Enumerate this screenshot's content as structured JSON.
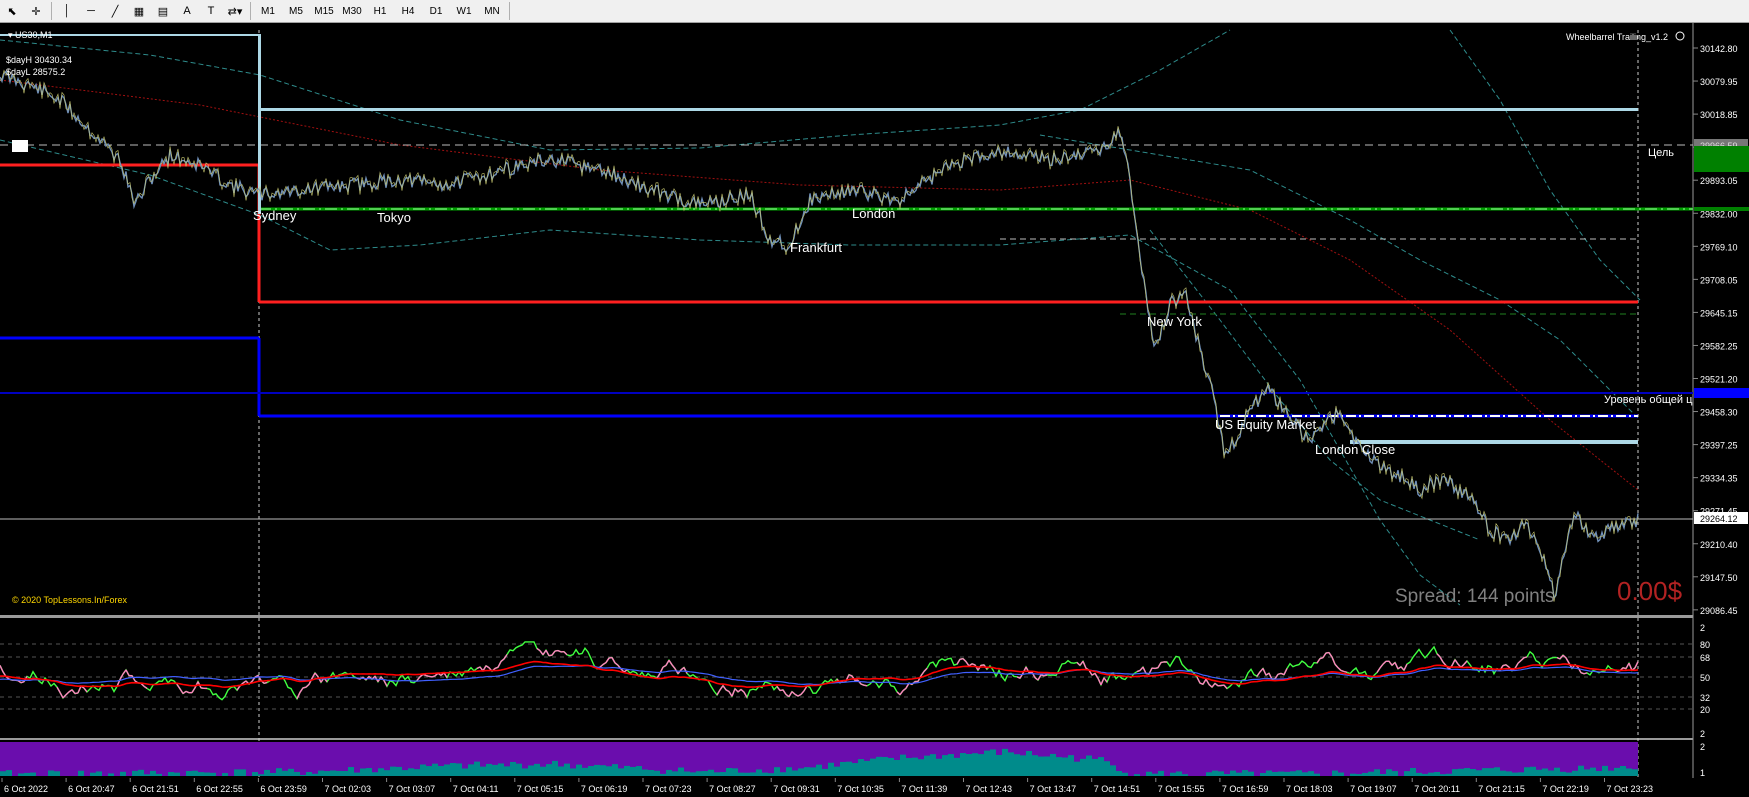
{
  "toolbar": {
    "tools": [
      {
        "name": "cursor-icon",
        "glyph": "⬉"
      },
      {
        "name": "crosshair-icon",
        "glyph": "✛"
      },
      {
        "name": "vertical-line-icon",
        "glyph": "│"
      },
      {
        "name": "horizontal-line-icon",
        "glyph": "─"
      },
      {
        "name": "trendline-icon",
        "glyph": "╱"
      },
      {
        "name": "fibonacci-icon",
        "glyph": "▦"
      },
      {
        "name": "fibonacci-fan-icon",
        "glyph": "▤"
      },
      {
        "name": "text-icon",
        "glyph": "A"
      },
      {
        "name": "text-label-icon",
        "glyph": "T"
      },
      {
        "name": "shapes-dropdown-icon",
        "glyph": "⇄▾"
      }
    ],
    "timeframes": [
      "M1",
      "M5",
      "M15",
      "M30",
      "H1",
      "H4",
      "D1",
      "W1",
      "MN"
    ]
  },
  "chart": {
    "symbol": "US30,M1",
    "day_high": "$dayH 30430.34",
    "day_low": "$dayL 28575.2",
    "indicator_name": "Wheelbarrel Trailing_v1.2",
    "copyright": "© 2020 TopLessons.In/Forex",
    "spread": "Spread: 144 points",
    "profit": "0.00$",
    "target_label": "Цель",
    "level_label": "Уровень общей ц",
    "current_price": "29264.12",
    "target_price": "29966.59",
    "sessions": [
      "Sydney",
      "Tokyo",
      "Frankfurt",
      "London",
      "New York",
      "US Equity Market",
      "London Close"
    ],
    "price_axis": [
      "30142.80",
      "30079.95",
      "30018.85",
      "29955.95",
      "29893.05",
      "29832.00",
      "29769.10",
      "29708.05",
      "29645.15",
      "29582.25",
      "29521.20",
      "29458.30",
      "29397.25",
      "29334.35",
      "29271.45",
      "29210.40",
      "29147.50",
      "29086.45"
    ],
    "osc_axis": [
      "2",
      "80",
      "68",
      "50",
      "32",
      "20",
      "2"
    ],
    "hist_axis": [
      "2",
      "1"
    ],
    "time_axis": [
      "6 Oct 2022",
      "6 Oct 20:47",
      "6 Oct 21:51",
      "6 Oct 22:55",
      "6 Oct 23:59",
      "7 Oct 02:03",
      "7 Oct 03:07",
      "7 Oct 04:11",
      "7 Oct 05:15",
      "7 Oct 06:19",
      "7 Oct 07:23",
      "7 Oct 08:27",
      "7 Oct 09:31",
      "7 Oct 10:35",
      "7 Oct 11:39",
      "7 Oct 12:43",
      "7 Oct 13:47",
      "7 Oct 14:51",
      "7 Oct 15:55",
      "7 Oct 16:59",
      "7 Oct 18:03",
      "7 Oct 19:07",
      "7 Oct 20:11",
      "7 Oct 21:15",
      "7 Oct 22:19",
      "7 Oct 23:23"
    ],
    "colors": {
      "background": "#000000",
      "candles": "#6f8fb8",
      "session_box": "#add8e6",
      "red_level": "#ff2020",
      "blue_level": "#0000ff",
      "green_level": "#00a000",
      "osc_green": "#40ff40",
      "osc_pink": "#ff80c0",
      "osc_red": "#ff0000",
      "osc_blue": "#4060ff",
      "hist_purple": "#6a0dad",
      "hist_teal": "#008b8b",
      "copyright": "#ffd700",
      "profit": "#b22222",
      "spread": "#808080"
    }
  }
}
